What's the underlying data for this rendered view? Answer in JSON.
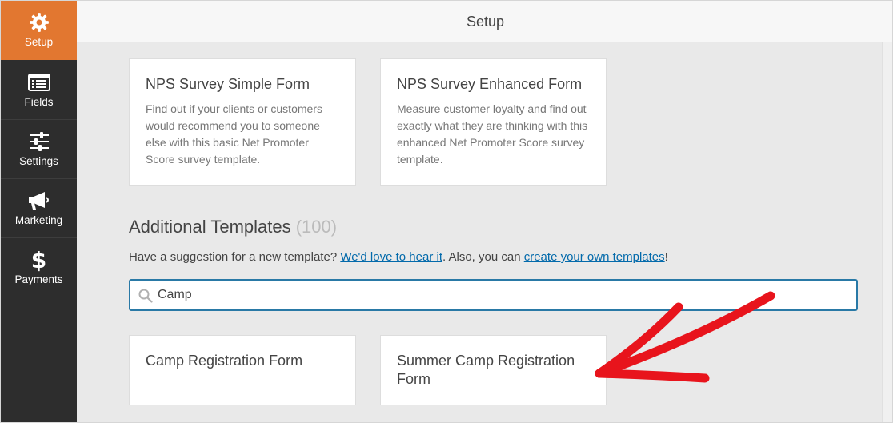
{
  "header": {
    "title": "Setup"
  },
  "sidebar": {
    "items": [
      {
        "label": "Setup",
        "icon": "gear-icon",
        "active": true
      },
      {
        "label": "Fields",
        "icon": "list-icon",
        "active": false
      },
      {
        "label": "Settings",
        "icon": "sliders-icon",
        "active": false
      },
      {
        "label": "Marketing",
        "icon": "megaphone-icon",
        "active": false
      },
      {
        "label": "Payments",
        "icon": "dollar-icon",
        "active": false
      }
    ]
  },
  "templates": [
    {
      "title": "NPS Survey Simple Form",
      "description": "Find out if your clients or customers would recommend you to someone else with this basic Net Promoter Score survey template."
    },
    {
      "title": "NPS Survey Enhanced Form",
      "description": "Measure customer loyalty and find out exactly what they are thinking with this enhanced Net Promoter Score survey template."
    }
  ],
  "additional": {
    "title": "Additional Templates",
    "count": "(100)",
    "suggest_prefix": "Have a suggestion for a new template? ",
    "suggest_link1": "We'd love to hear it",
    "suggest_middle": ". Also, you can ",
    "suggest_link2": "create your own templates",
    "suggest_suffix": "!"
  },
  "search": {
    "value": "Camp",
    "placeholder": ""
  },
  "results": [
    {
      "title": "Camp Registration Form"
    },
    {
      "title": "Summer Camp Registration Form"
    }
  ],
  "colors": {
    "accent": "#e27730",
    "sidebar": "#2d2d2d",
    "link": "#036aab",
    "search_border": "#2979a6",
    "arrow": "#e8141c"
  }
}
